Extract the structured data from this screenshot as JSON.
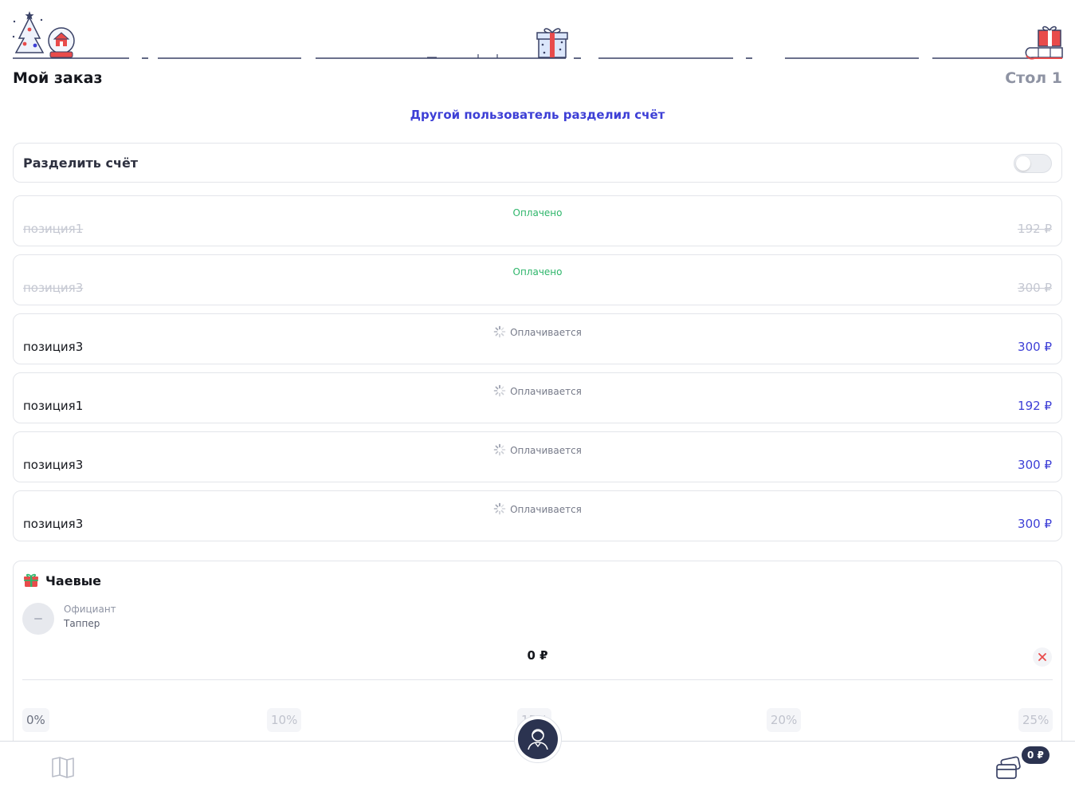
{
  "header": {
    "title": "Мой заказ",
    "table": "Стол 1",
    "split_notice": "Другой пользователь разделил счёт"
  },
  "split": {
    "label": "Разделить счёт",
    "enabled": false
  },
  "items": [
    {
      "name": "позиция1",
      "price": "192 ₽",
      "status": "Оплачено",
      "state": "paid"
    },
    {
      "name": "позиция3",
      "price": "300 ₽",
      "status": "Оплачено",
      "state": "paid"
    },
    {
      "name": "позиция3",
      "price": "300 ₽",
      "status": "Оплачивается",
      "state": "paying"
    },
    {
      "name": "позиция1",
      "price": "192 ₽",
      "status": "Оплачивается",
      "state": "paying"
    },
    {
      "name": "позиция3",
      "price": "300 ₽",
      "status": "Оплачивается",
      "state": "paying"
    },
    {
      "name": "позиция3",
      "price": "300 ₽",
      "status": "Оплачивается",
      "state": "paying"
    }
  ],
  "tips": {
    "title": "Чаевые",
    "icon": "gift-icon",
    "role": "Официант",
    "waiter_name": "Таппер",
    "amount": "0 ₽",
    "percents": [
      "0%",
      "10%",
      "15%",
      "20%",
      "25%"
    ],
    "selected_percent": "0%"
  },
  "bottom_bar": {
    "menu_icon": "book-icon",
    "center_icon": "waiter-icon",
    "cart_icon": "card-icon",
    "cart_badge": "0 ₽"
  },
  "colors": {
    "accent": "#3d3fd6",
    "paid": "#2fb66b",
    "dark": "#2b3350",
    "danger": "#e84b4b"
  }
}
